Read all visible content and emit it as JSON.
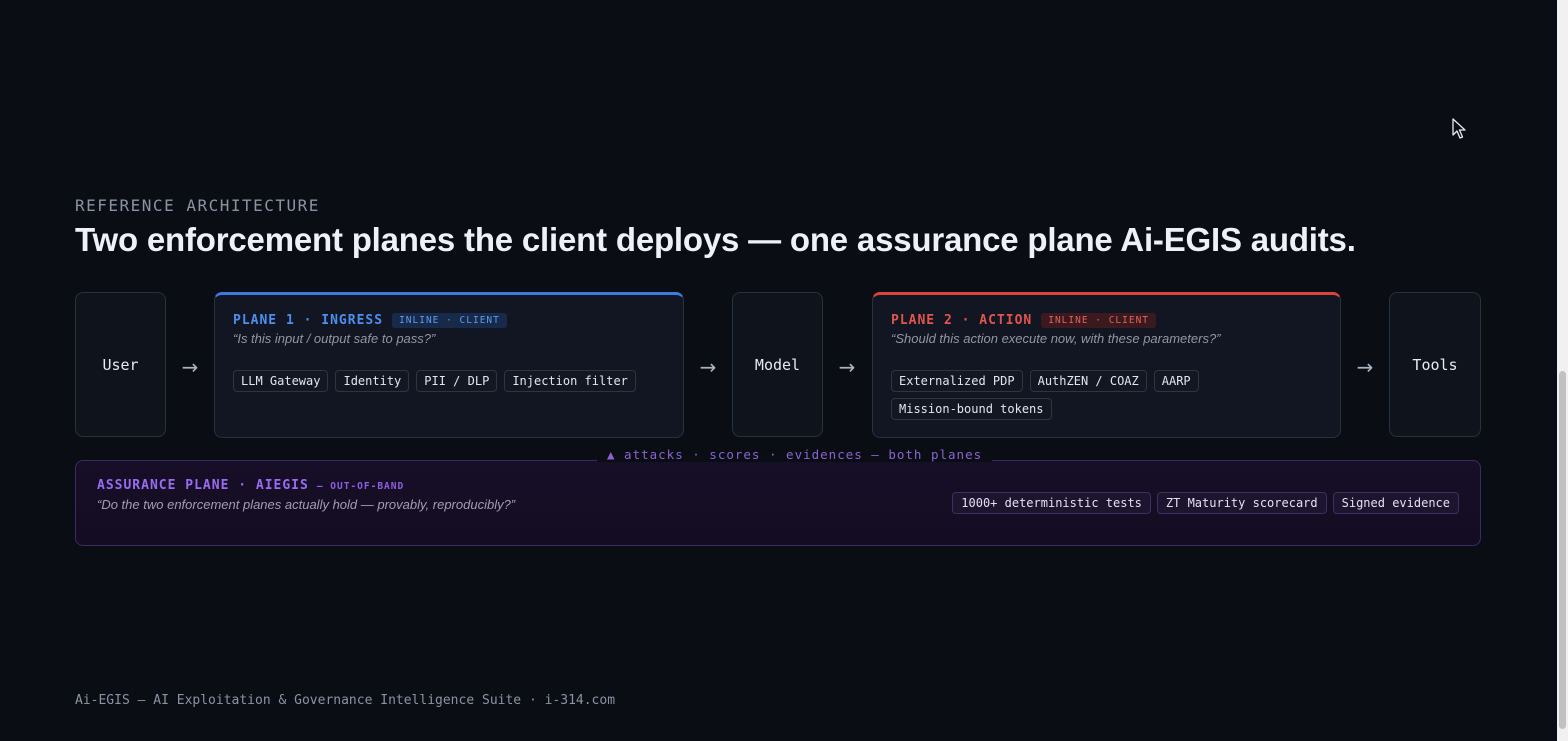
{
  "header": {
    "eyebrow": "REFERENCE ARCHITECTURE",
    "title": "Two enforcement planes the client deploys — one assurance plane Ai-EGIS audits."
  },
  "flow": {
    "user_label": "User",
    "model_label": "Model",
    "tools_label": "Tools",
    "arrow": "→"
  },
  "plane1": {
    "title": "PLANE 1 · INGRESS",
    "badge": "INLINE · CLIENT",
    "question": "“Is this input / output safe to pass?”",
    "chips": [
      "LLM Gateway",
      "Identity",
      "PII / DLP",
      "Injection filter"
    ],
    "accent": "#3b7be0"
  },
  "plane2": {
    "title": "PLANE 2 · ACTION",
    "badge": "INLINE · CLIENT",
    "question": "“Should this action execute now, with these parameters?”",
    "chips": [
      "Externalized PDP",
      "AuthZEN / COAZ",
      "AARP",
      "Mission-bound tokens"
    ],
    "accent": "#d9443f"
  },
  "assurance": {
    "caption": "▲ attacks · scores · evidences — both planes",
    "title": "ASSURANCE PLANE · AIEGIS",
    "tag": "— OUT-OF-BAND",
    "question": "“Do the two enforcement planes actually hold — provably, reproducibly?”",
    "chips": [
      "1000+ deterministic tests",
      "ZT Maturity scorecard",
      "Signed evidence"
    ],
    "accent": "#8a5cf0"
  },
  "footer": {
    "text": "Ai-EGIS — AI Exploitation & Governance Intelligence Suite · i-314.com"
  }
}
